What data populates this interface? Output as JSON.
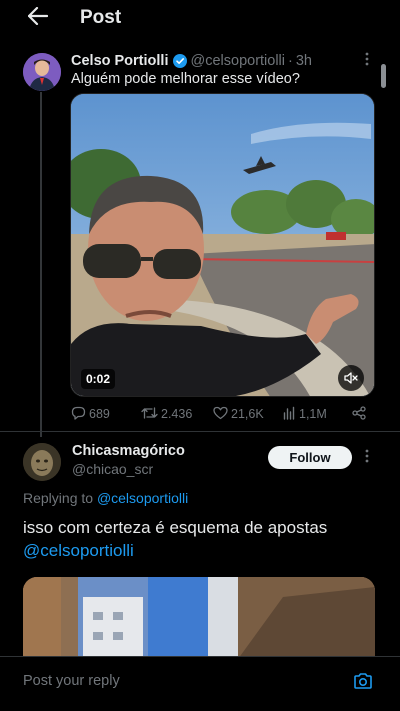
{
  "header": {
    "title": "Post"
  },
  "tweet": {
    "author_name": "Celso Portiolli",
    "handle": "@celsoportiolli",
    "separator": "·",
    "time": "3h",
    "text": "Alguém pode melhorar esse vídeo?",
    "video_duration": "0:02",
    "stats": {
      "replies": "689",
      "reposts": "2.436",
      "likes": "21,6K",
      "views": "1,1M"
    }
  },
  "reply": {
    "author_name": "Chicasmagórico",
    "handle": "@chicao_scr",
    "follow_label": "Follow",
    "replying_prefix": "Replying to",
    "replying_to": "@celsoportiolli",
    "text": "isso com certeza é esquema de apostas",
    "mention": "@celsoportiolli"
  },
  "compose": {
    "placeholder": "Post your reply"
  },
  "colors": {
    "accent": "#1d9bf0",
    "background": "#000000",
    "muted": "#71767b",
    "text": "#e7e9ea"
  },
  "icons": {
    "back": "arrow-left-icon",
    "verified": "verified-badge-icon",
    "more": "more-dots-icon",
    "mute": "volume-muted-icon",
    "reply": "reply-icon",
    "repost": "repost-icon",
    "like": "heart-icon",
    "views": "views-icon",
    "share": "share-icon",
    "camera": "camera-icon"
  }
}
